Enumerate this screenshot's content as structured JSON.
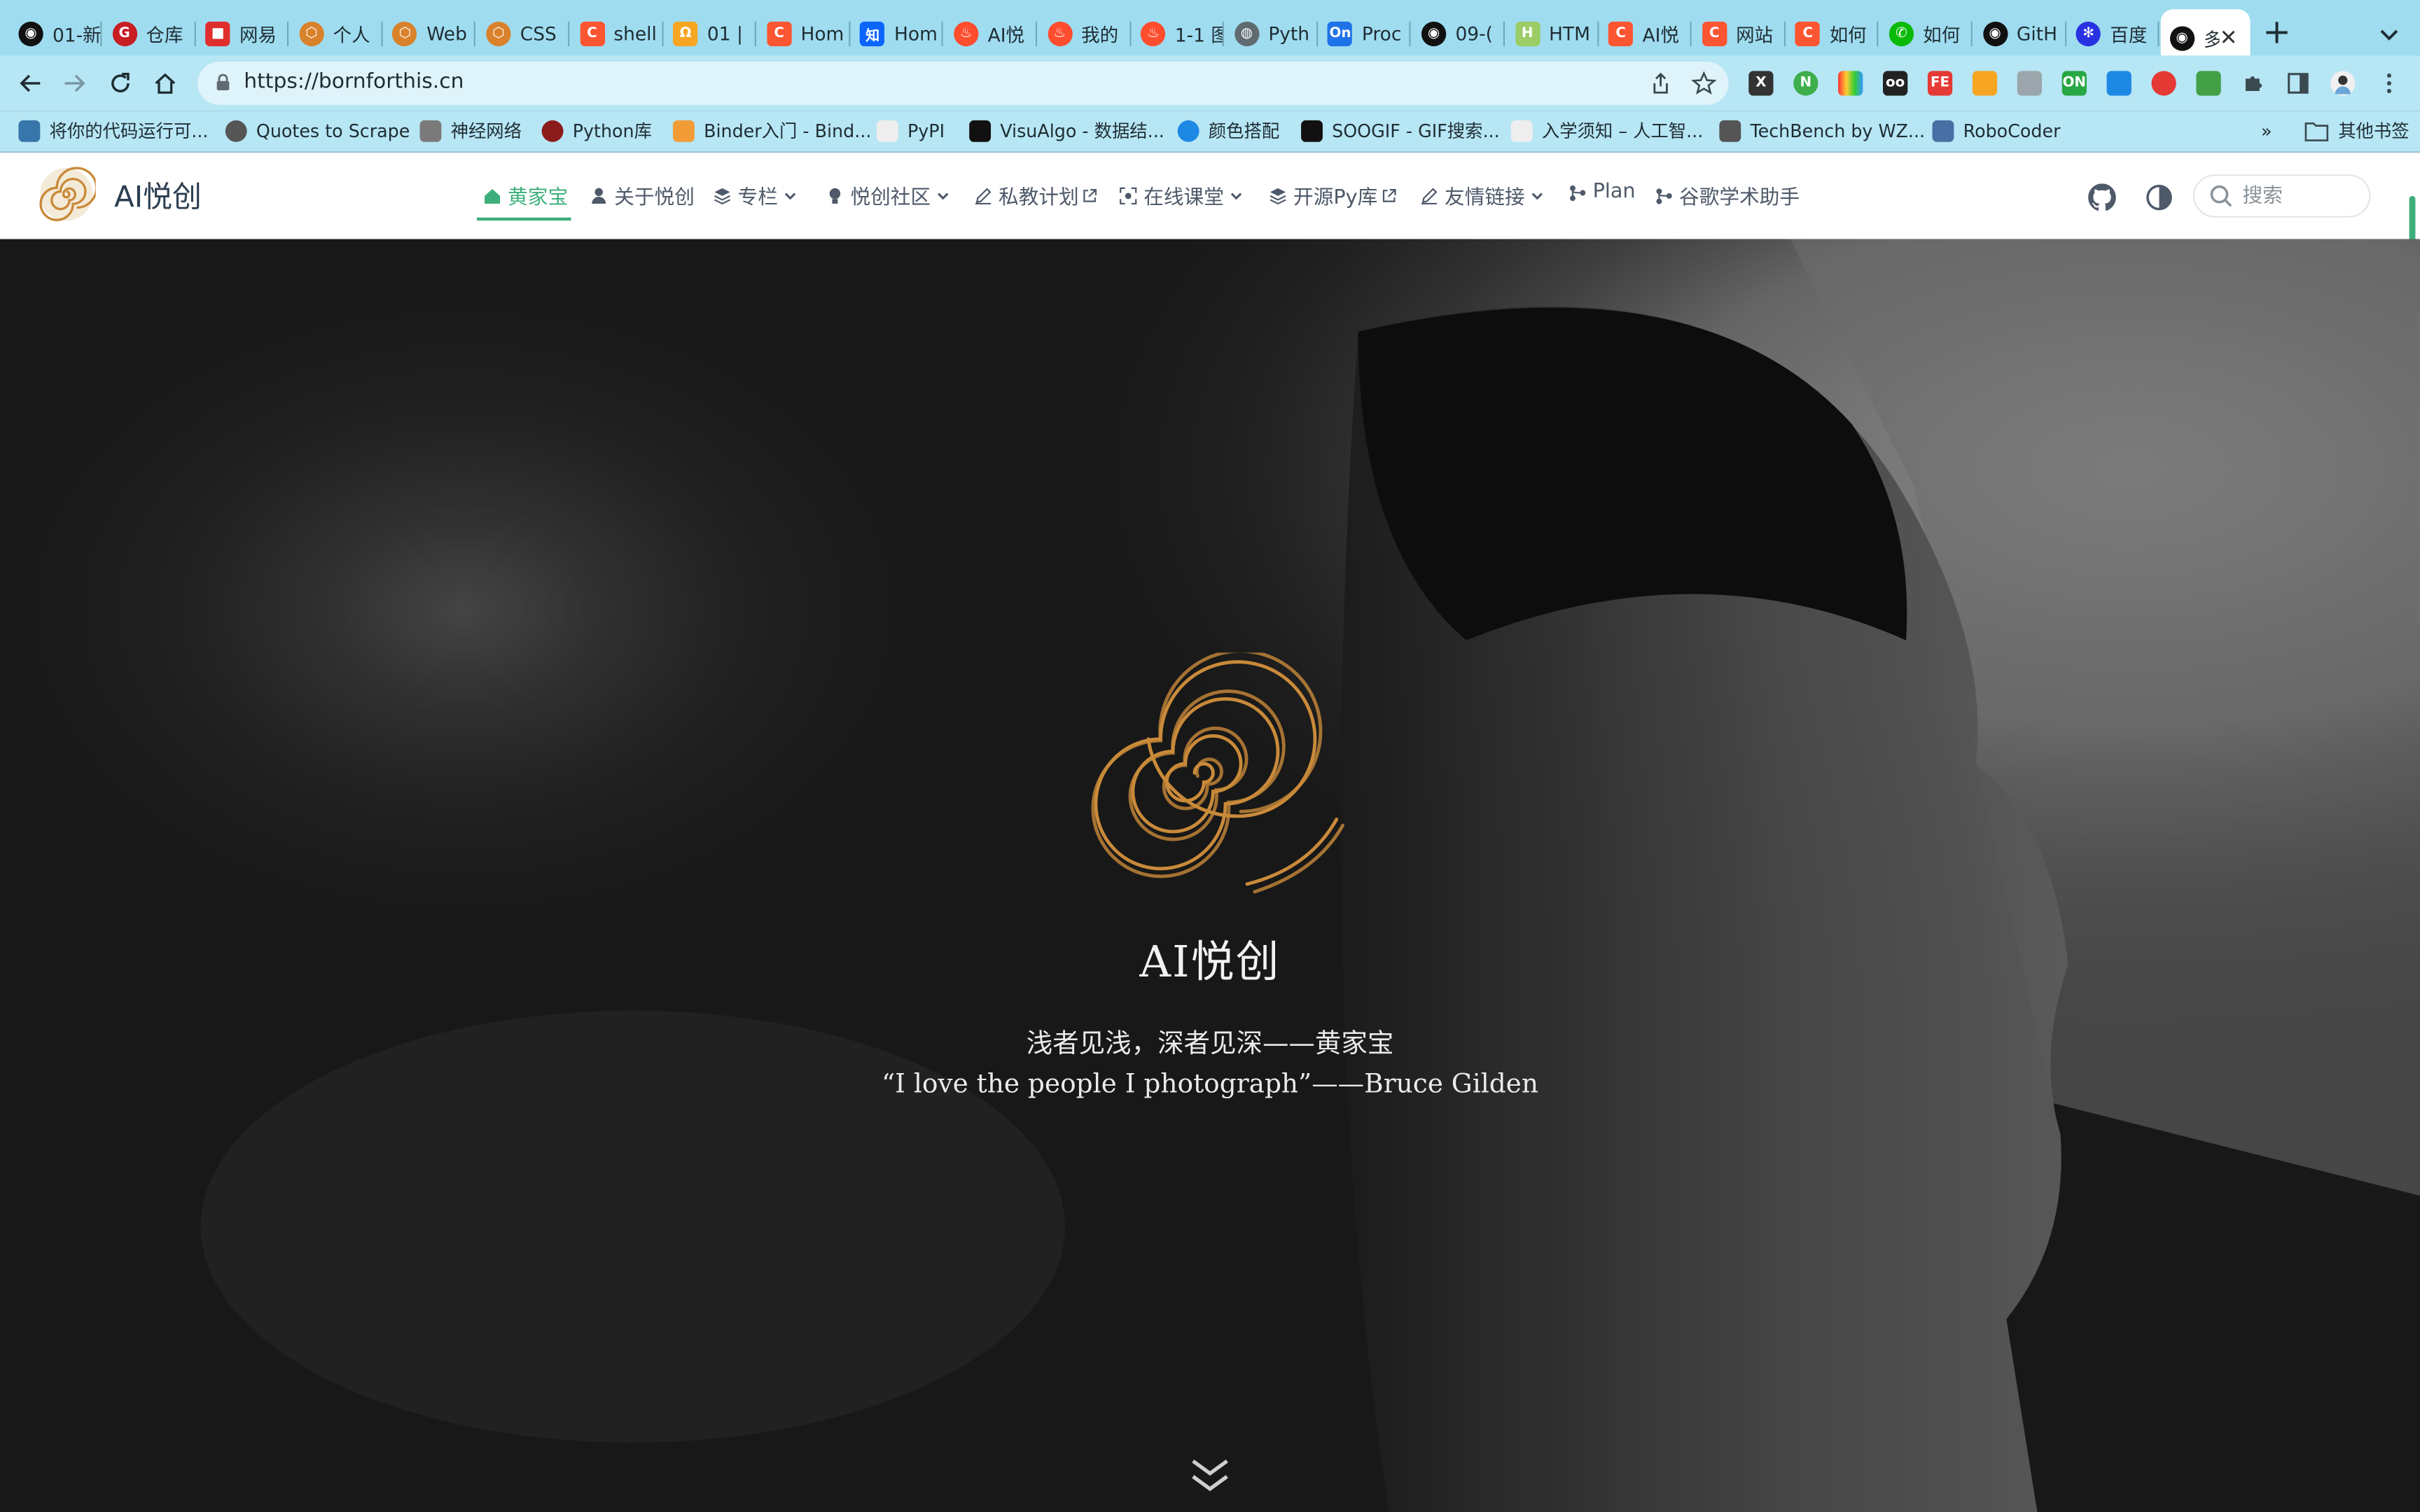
{
  "browser": {
    "tabs": [
      {
        "title": "01-新",
        "icon": "github-icon"
      },
      {
        "title": "仓库",
        "icon": "gitee-icon"
      },
      {
        "title": "网易",
        "icon": "netease-icon"
      },
      {
        "title": "个人",
        "icon": "honeycomb-icon"
      },
      {
        "title": "Web",
        "icon": "honeycomb-icon"
      },
      {
        "title": "CSS",
        "icon": "honeycomb-icon"
      },
      {
        "title": "shell",
        "icon": "csdn-icon"
      },
      {
        "title": "01 |",
        "icon": "geek-icon"
      },
      {
        "title": "Hom",
        "icon": "csdn-icon"
      },
      {
        "title": "Hom",
        "icon": "zhihu-icon"
      },
      {
        "title": "AI悦",
        "icon": "flame-icon"
      },
      {
        "title": "我的",
        "icon": "flame-icon"
      },
      {
        "title": "1-1 图",
        "icon": "flame-icon"
      },
      {
        "title": "Pyth",
        "icon": "globe-icon"
      },
      {
        "title": "Proc",
        "icon": "on-icon"
      },
      {
        "title": "09-(",
        "icon": "github-icon"
      },
      {
        "title": "HTM",
        "icon": "html-icon"
      },
      {
        "title": "AI悦",
        "icon": "csdn-icon"
      },
      {
        "title": "网站",
        "icon": "csdn-icon"
      },
      {
        "title": "如何",
        "icon": "csdn-icon"
      },
      {
        "title": "如何",
        "icon": "wechat-icon"
      },
      {
        "title": "GitH",
        "icon": "github-icon"
      },
      {
        "title": "百度",
        "icon": "baidu-icon"
      },
      {
        "title": "多",
        "icon": "github-icon",
        "active": true
      }
    ],
    "new_tab": "+",
    "url": "https://bornforthis.cn",
    "bookmarks": [
      {
        "label": "将你的代码运行可..."
      },
      {
        "label": "Quotes to Scrape"
      },
      {
        "label": "神经网络"
      },
      {
        "label": "Python库"
      },
      {
        "label": "Binder入门 - Bind..."
      },
      {
        "label": "PyPI"
      },
      {
        "label": "VisuAlgo - 数据结..."
      },
      {
        "label": "颜色搭配"
      },
      {
        "label": "SOOGIF - GIF搜索..."
      },
      {
        "label": "入学须知 – 人工智..."
      },
      {
        "label": "TechBench by WZ..."
      },
      {
        "label": "RoboCoder"
      }
    ],
    "more_bookmarks": "»",
    "other_bookmarks": "其他书签"
  },
  "site": {
    "brand": "AI悦创",
    "nav": [
      {
        "label": "黄家宝",
        "icon": "home-icon",
        "active": true
      },
      {
        "label": "关于悦创",
        "icon": "user-icon"
      },
      {
        "label": "专栏",
        "icon": "layers-icon",
        "dropdown": true
      },
      {
        "label": "悦创社区",
        "icon": "bulb-icon",
        "dropdown": true
      },
      {
        "label": "私教计划",
        "icon": "pen-icon",
        "external": true
      },
      {
        "label": "在线课堂",
        "icon": "focus-icon",
        "dropdown": true
      },
      {
        "label": "开源Py库",
        "icon": "layers-icon",
        "external": true
      },
      {
        "label": "友情链接",
        "icon": "pen-icon",
        "dropdown": true
      },
      {
        "label": "Plan",
        "icon": "branch-icon"
      },
      {
        "label": "谷歌学术助手",
        "icon": "branch-icon"
      }
    ],
    "search_placeholder": "搜索",
    "accent": "#3eaf7c"
  },
  "hero": {
    "title": "AI悦创",
    "tagline": "浅者见浅，深者见深——黄家宝",
    "quote": "“I love the people I photograph”——Bruce Gilden",
    "logo_color": "#c98a3a"
  }
}
